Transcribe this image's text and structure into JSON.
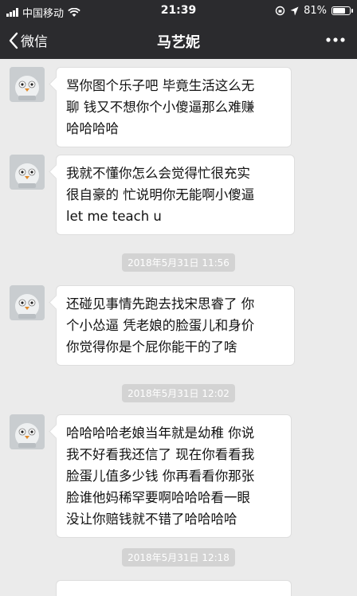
{
  "status": {
    "carrier": "中国移动",
    "time": "21:39",
    "battery": "81%",
    "battery_level": 0.81
  },
  "nav": {
    "back_label": "微信",
    "title": "马艺妮"
  },
  "messages": [
    {
      "text": "骂你图个乐子吧 毕竟生活这么无\n聊 钱又不想你个小傻逼那么难赚\n哈哈哈哈"
    },
    {
      "text": "我就不懂你怎么会觉得忙很充实\n很自豪的 忙说明你无能啊小傻逼\nlet me teach u"
    },
    {
      "text": "还碰见事情先跑去找宋思睿了 你\n个小怂逼 凭老娘的脸蛋儿和身价\n你觉得你是个屁你能干的了啥"
    },
    {
      "text": "哈哈哈哈老娘当年就是幼稚 你说\n我不好看我还信了 现在你看看我\n脸蛋儿值多少钱 你再看看你那张\n脸谁他妈稀罕要啊哈哈哈看一眼\n没让你赔钱就不错了哈哈哈哈"
    }
  ],
  "timestamps": [
    "2018年5月31日 11:56",
    "2018年5月31日 12:02",
    "2018年5月31日 12:18"
  ]
}
